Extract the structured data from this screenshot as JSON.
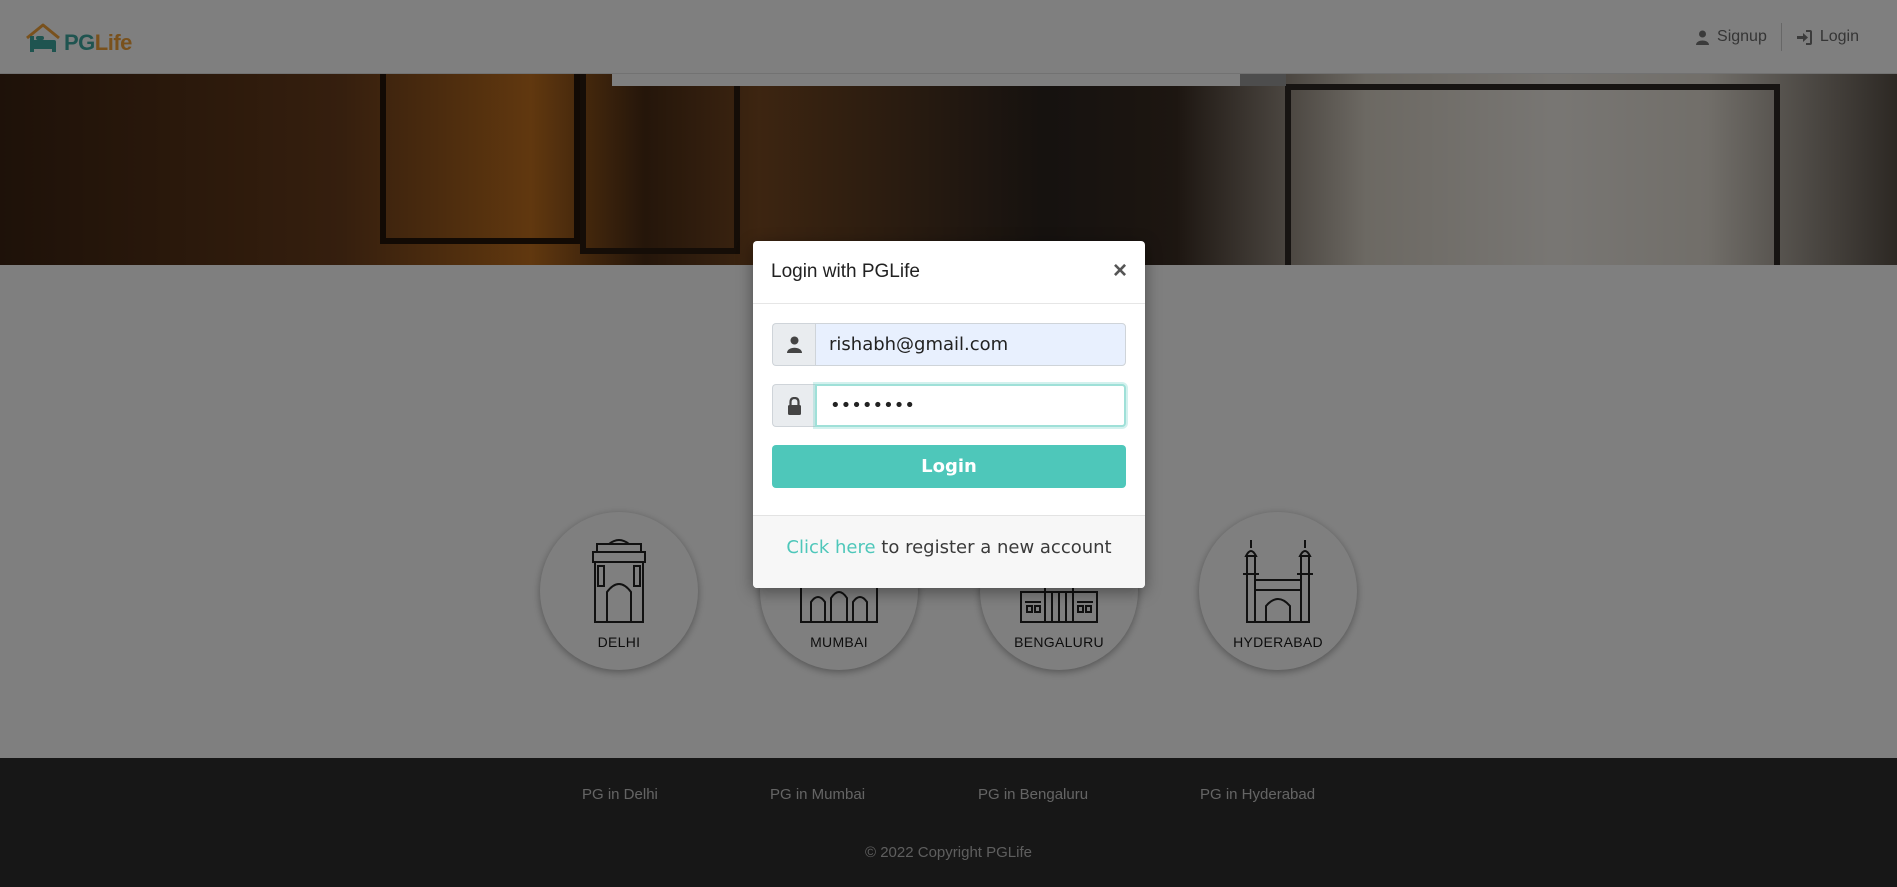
{
  "header": {
    "logo_pg": "PG",
    "logo_life": "Life",
    "signup_label": "Signup",
    "login_label": "Login"
  },
  "cities": [
    {
      "label": "DELHI",
      "icon": "india-gate-icon"
    },
    {
      "label": "MUMBAI",
      "icon": "gateway-of-india-icon"
    },
    {
      "label": "BENGALURU",
      "icon": "vidhana-soudha-icon"
    },
    {
      "label": "HYDERABAD",
      "icon": "charminar-icon"
    }
  ],
  "footer": {
    "links": [
      "PG in Delhi",
      "PG in Mumbai",
      "PG in Bengaluru",
      "PG in Hyderabad"
    ],
    "copyright": "© 2022 Copyright PGLife"
  },
  "modal": {
    "title": "Login with PGLife",
    "close": "×",
    "email_value": "rishabh@gmail.com",
    "password_value": "••••••••",
    "login_button": "Login",
    "register_link": "Click here",
    "register_text": " to register a new account"
  },
  "colors": {
    "accent": "#4ec7ba",
    "logo_pg": "#3fa8a0",
    "logo_life": "#f2a33a",
    "footer_bg": "#2f2f2f"
  }
}
